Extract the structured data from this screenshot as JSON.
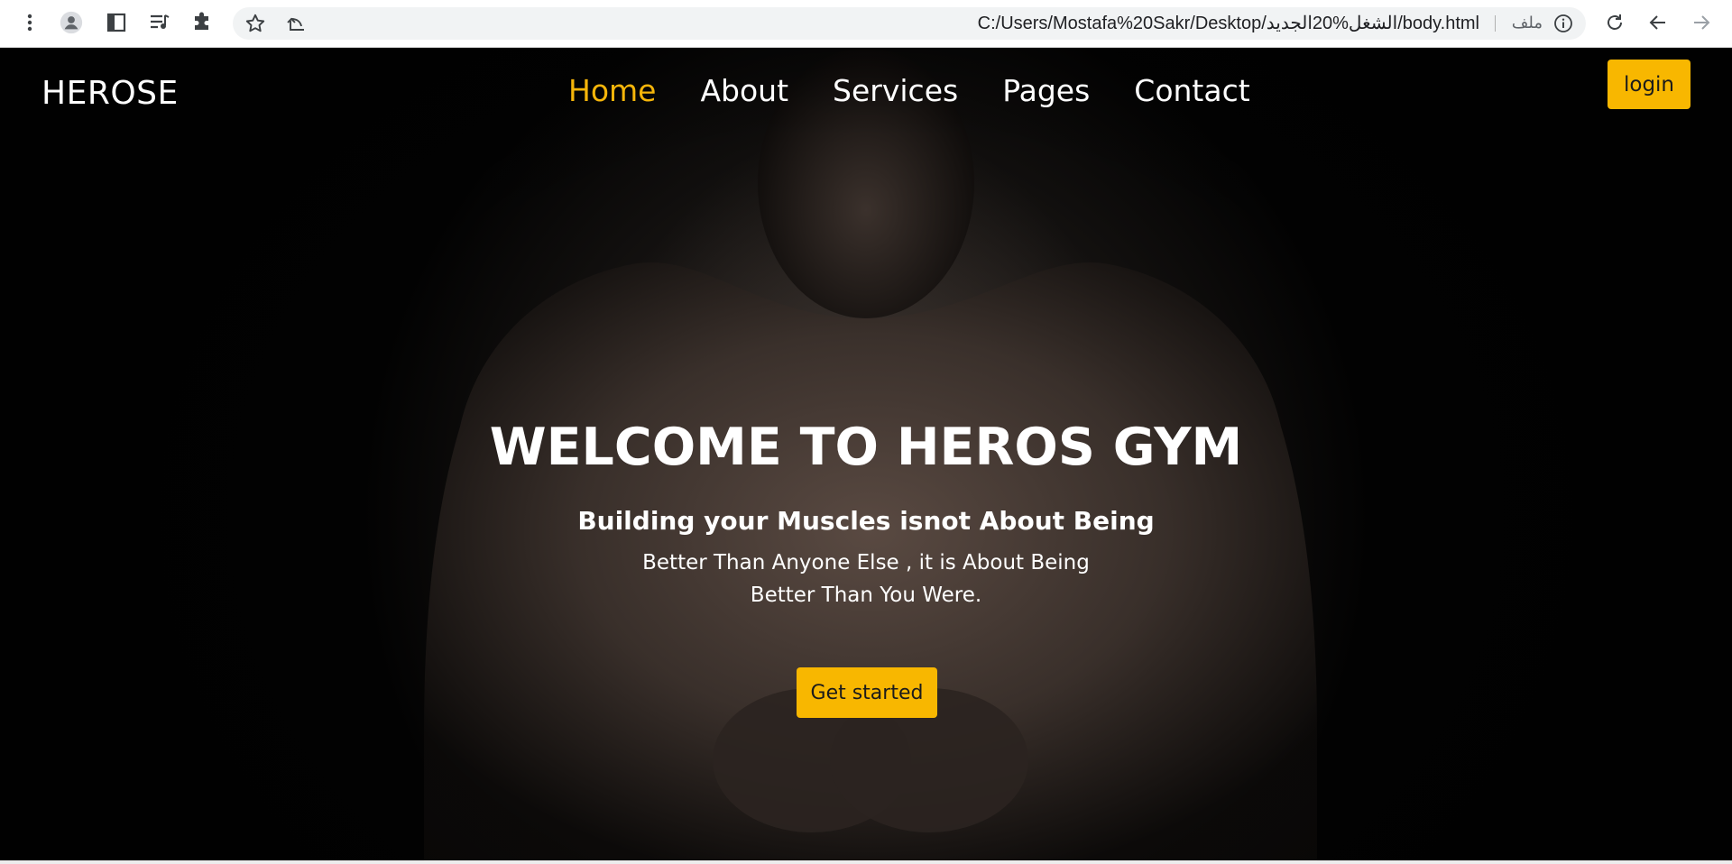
{
  "browser": {
    "url": "C:/Users/Mostafa%20Sakr/Desktop/الشغل%20الجديد/body.html",
    "scheme_label": "ملف",
    "icons": [
      "more-vert-icon",
      "profile-icon",
      "side-panel-icon",
      "reading-list-icon",
      "extensions-icon",
      "bookmark-star-icon",
      "share-icon",
      "site-info-icon",
      "reload-icon",
      "back-icon",
      "forward-icon"
    ]
  },
  "nav": {
    "logo": "HEROSE",
    "links": [
      {
        "label": "Home",
        "active": true
      },
      {
        "label": "About",
        "active": false
      },
      {
        "label": "Services",
        "active": false
      },
      {
        "label": "Pages",
        "active": false
      },
      {
        "label": "Contact",
        "active": false
      }
    ],
    "login_label": "login"
  },
  "hero": {
    "title": "WELCOME TO HEROS GYM",
    "subtitle": "Building your Muscles isnot About Being",
    "line1": "Better Than Anyone Else , it is About Being",
    "line2": "Better Than You Were.",
    "cta_label": "Get started"
  },
  "colors": {
    "accent": "#f8b700",
    "active_link": "#f5b50a",
    "background": "#000000",
    "text": "#ffffff"
  }
}
